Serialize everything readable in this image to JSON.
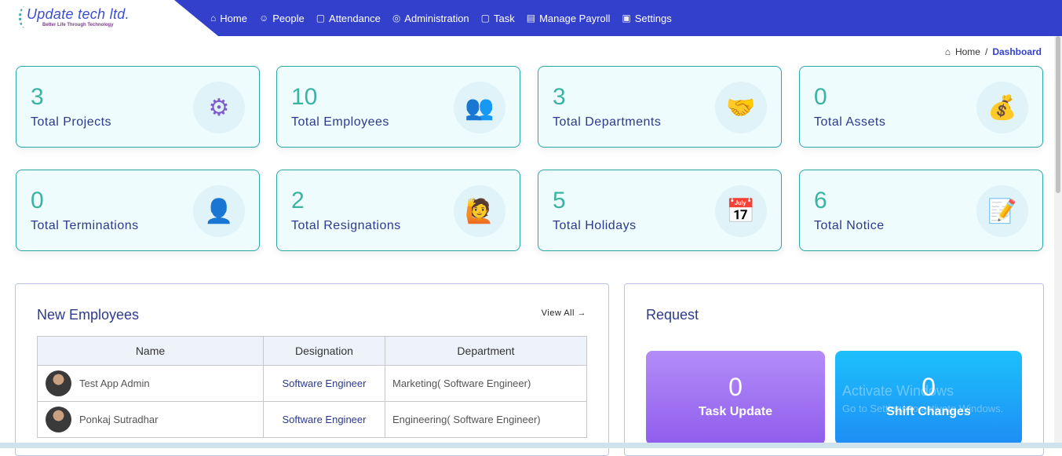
{
  "brand": {
    "name": "Update tech ltd.",
    "tagline": "Better Life Through Technology"
  },
  "nav": [
    {
      "label": "Home",
      "icon": "⌂"
    },
    {
      "label": "People",
      "icon": "☺"
    },
    {
      "label": "Attendance",
      "icon": "▢"
    },
    {
      "label": "Administration",
      "icon": "◎"
    },
    {
      "label": "Task",
      "icon": "▢"
    },
    {
      "label": "Manage Payroll",
      "icon": "▤"
    },
    {
      "label": "Settings",
      "icon": "▣"
    }
  ],
  "breadcrumb": {
    "home": "Home",
    "sep": "/",
    "current": "Dashboard"
  },
  "stats": [
    {
      "value": "3",
      "label": "Total Projects",
      "icon": "⚙"
    },
    {
      "value": "10",
      "label": "Total Employees",
      "icon": "👥"
    },
    {
      "value": "3",
      "label": "Total Departments",
      "icon": "🤝"
    },
    {
      "value": "0",
      "label": "Total Assets",
      "icon": "💰"
    },
    {
      "value": "0",
      "label": "Total Terminations",
      "icon": "👤"
    },
    {
      "value": "2",
      "label": "Total Resignations",
      "icon": "🙋"
    },
    {
      "value": "5",
      "label": "Total Holidays",
      "icon": "📅"
    },
    {
      "value": "6",
      "label": "Total Notice",
      "icon": "📝"
    }
  ],
  "new_employees": {
    "title": "New Employees",
    "view_all": "View All →",
    "columns": [
      "Name",
      "Designation",
      "Department"
    ],
    "rows": [
      {
        "name": "Test App Admin",
        "designation": "Software Engineer",
        "department": "Marketing( Software Engineer)"
      },
      {
        "name": "Ponkaj Sutradhar",
        "designation": "Software Engineer",
        "department": "Engineering( Software Engineer)"
      }
    ]
  },
  "request": {
    "title": "Request",
    "items": [
      {
        "value": "0",
        "label": "Task Update"
      },
      {
        "value": "0",
        "label": "Shift Changes"
      }
    ]
  },
  "watermark": {
    "line1": "Activate Windows",
    "line2": "Go to Settings to activate Windows."
  },
  "colors": {
    "nav": "#3340cc",
    "accent": "#3bb3a3",
    "task": "#9b6cf0",
    "shift": "#1ea6f7"
  }
}
